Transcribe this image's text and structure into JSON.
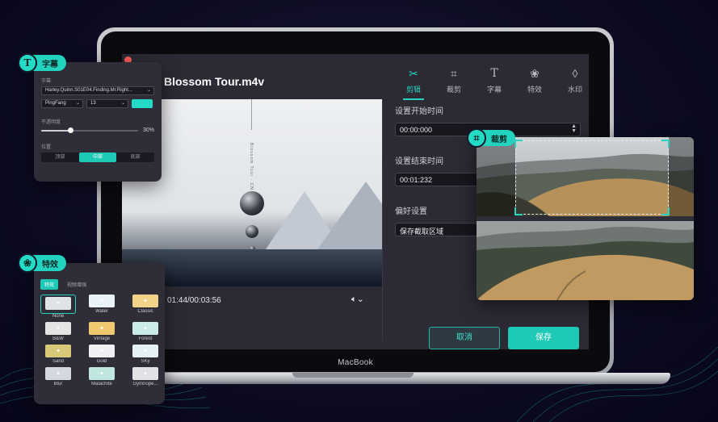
{
  "editor": {
    "file_title": "Blossom Tour.m4v",
    "tabs": [
      {
        "label": "剪辑",
        "icon": "scissors-icon",
        "active": true
      },
      {
        "label": "裁剪",
        "icon": "crop-icon"
      },
      {
        "label": "字幕",
        "icon": "text-icon"
      },
      {
        "label": "特效",
        "icon": "effects-icon"
      },
      {
        "label": "水印",
        "icon": "watermark-drop-icon"
      }
    ],
    "video": {
      "vertical_text": "Blossom Tour · CN"
    },
    "player": {
      "timecode": "01:44/00:03:56",
      "volume_icon": "volume-icon"
    },
    "settings": {
      "start_label": "设置开始时间",
      "start_value": "00:00:000",
      "end_label": "设置结束时间",
      "end_value": "00:01:232",
      "pref_label": "偏好设置",
      "pref_value": "保存截取区域"
    },
    "cancel_label": "取消",
    "save_label": "保存"
  },
  "laptop": {
    "brand": "MacBook"
  },
  "subtitle_panel": {
    "badge": "字幕",
    "file_label": "字幕",
    "file_value": "Harley.Quinn.S01E04.Finding.Mr.Right...",
    "font_value": "PingFang",
    "size_value": "13",
    "opacity_label": "不透明度",
    "opacity_value": "30%",
    "opacity_fraction": 0.3,
    "position_label": "位置",
    "positions": [
      "顶部",
      "中部",
      "底部"
    ],
    "active_position": 1,
    "accent": "#24dcc6"
  },
  "effects_panel": {
    "badge": "特效",
    "tabs": [
      "特效",
      "视频增强"
    ],
    "items": [
      {
        "name": "None",
        "color": "#dfe3e8",
        "selected": true
      },
      {
        "name": "Water",
        "color": "#e8f2f8"
      },
      {
        "name": "Classic",
        "color": "#f3d28a"
      },
      {
        "name": "B&W",
        "color": "#e4e4e4"
      },
      {
        "name": "Vintage",
        "color": "#f0c870"
      },
      {
        "name": "Forest",
        "color": "#c9ecea"
      },
      {
        "name": "Sand",
        "color": "#d8c979"
      },
      {
        "name": "Gold",
        "color": "#eef0f4"
      },
      {
        "name": "SKy",
        "color": "#e6f1f7"
      },
      {
        "name": "Blur",
        "color": "#d4d9e0"
      },
      {
        "name": "Malachite",
        "color": "#bfe6df"
      },
      {
        "name": "Gymnope...",
        "color": "#e0e2e5"
      }
    ]
  },
  "crop_panel": {
    "badge": "裁剪"
  }
}
